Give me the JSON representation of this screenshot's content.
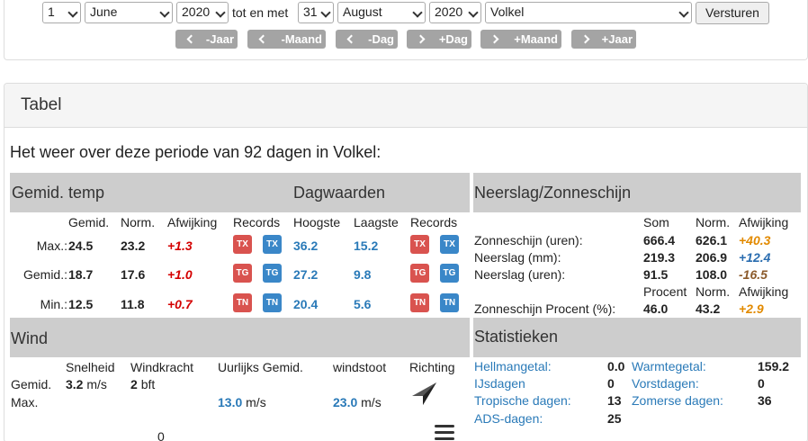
{
  "filter": {
    "from_day": "1",
    "from_month": "June",
    "from_year": "2020",
    "range_label": "tot en met",
    "to_day": "31",
    "to_month": "August",
    "to_year": "2020",
    "station": "Volkel",
    "submit_label": "Versturen",
    "nav": [
      "-Jaar",
      "-Maand",
      "-Dag",
      "+Dag",
      "+Maand",
      "+Jaar"
    ]
  },
  "tabel": {
    "title": "Tabel",
    "intro": "Het weer over deze periode van 92 dagen in Volkel:"
  },
  "temp": {
    "header_left": "Gemid. temp",
    "header_right": "Dagwaarden",
    "cols": {
      "gemid": "Gemid.",
      "norm": "Norm.",
      "afwijking": "Afwijking",
      "records": "Records",
      "hoogste": "Hoogste",
      "laagste": "Laagste",
      "records2": "Records"
    },
    "rows": [
      {
        "label": "Max.:",
        "gemid": "24.5",
        "norm": "23.2",
        "afw": "+1.3",
        "badge": "TX",
        "hoogste": "36.2",
        "laagste": "15.2"
      },
      {
        "label": "Gemid.:",
        "gemid": "18.7",
        "norm": "17.6",
        "afw": "+1.0",
        "badge": "TG",
        "hoogste": "27.2",
        "laagste": "9.8"
      },
      {
        "label": "Min.:",
        "gemid": "12.5",
        "norm": "11.8",
        "afw": "+0.7",
        "badge": "TN",
        "hoogste": "20.4",
        "laagste": "5.6"
      }
    ]
  },
  "neerslag": {
    "header": "Neerslag/Zonneschijn",
    "cols": {
      "som": "Som",
      "norm": "Norm.",
      "afwijking": "Afwijking"
    },
    "rows": [
      {
        "label": "Zonneschijn (uren):",
        "som": "666.4",
        "norm": "626.1",
        "afw": "+40.3"
      },
      {
        "label": "Neerslag (mm):",
        "som": "219.3",
        "norm": "206.9",
        "afw": "+12.4"
      },
      {
        "label": "Neerslag (uren):",
        "som": "91.5",
        "norm": "108.0",
        "afw": "-16.5"
      }
    ],
    "cols2": {
      "procent": "Procent",
      "norm": "Norm.",
      "afwijking": "Afwijking"
    },
    "pct_row": {
      "label": "Zonneschijn Procent (%):",
      "procent": "46.0",
      "norm": "43.2",
      "afw": "+2.9"
    }
  },
  "wind": {
    "header": "Wind",
    "cols": {
      "snelheid": "Snelheid",
      "windkracht": "Windkracht",
      "uurlijks": "Uurlijks Gemid.",
      "windstoot": "windstoot",
      "richting": "Richting"
    },
    "gemid_label": "Gemid.",
    "max_label": "Max.",
    "snelheid_value": "3.2",
    "snelheid_unit": "m/s",
    "windkracht_value": "2",
    "windkracht_unit": "bft",
    "uurlijks_value": "13.0",
    "uurlijks_unit": "m/s",
    "windstoot_value": "23.0",
    "windstoot_unit": "m/s",
    "bottom_value": "0"
  },
  "statistieken": {
    "header": "Statistieken",
    "left": [
      {
        "label": "Hellmangetal:",
        "value": "0.0"
      },
      {
        "label": "IJsdagen",
        "value": "0"
      },
      {
        "label": "Tropische dagen:",
        "value": "13"
      },
      {
        "label": "ADS-dagen:",
        "value": "25"
      }
    ],
    "right": [
      {
        "label": "Warmtegetal:",
        "value": "159.2"
      },
      {
        "label": "Vorstdagen:",
        "value": "0"
      },
      {
        "label": "Zomerse dagen:",
        "value": "36"
      }
    ]
  }
}
